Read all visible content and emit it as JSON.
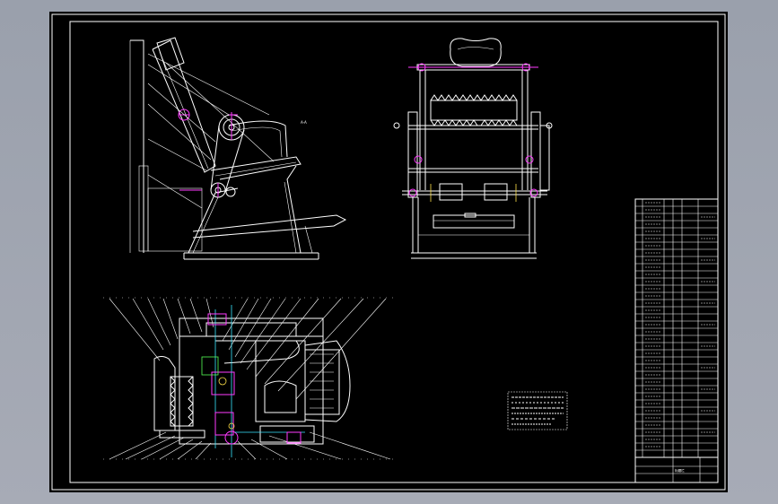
{
  "drawing": {
    "side_view_label": "A-A",
    "bom_caption": "标题栏"
  }
}
